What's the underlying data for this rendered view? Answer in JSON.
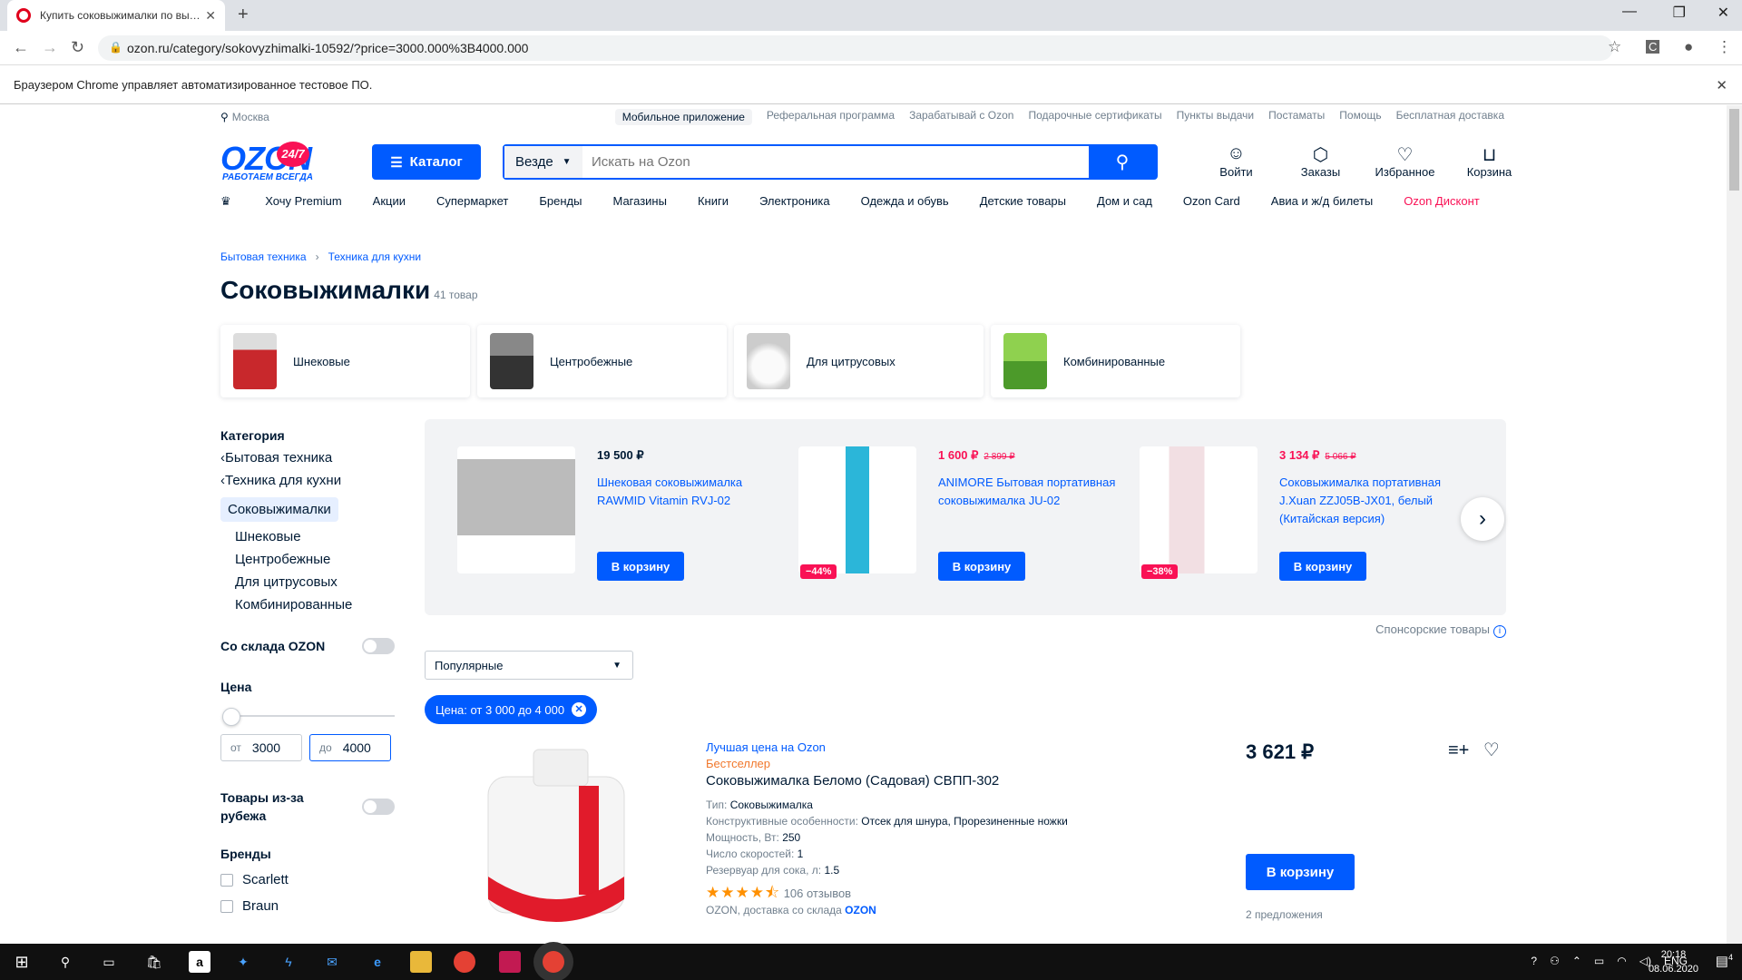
{
  "browser": {
    "tab_title": "Купить соковыжималки по вы…",
    "url": "ozon.ru/category/sokovyzhimalki-10592/?price=3000.000%3B4000.000",
    "infobar": "Браузером Chrome управляет автоматизированное тестовое ПО."
  },
  "header": {
    "city": "Москва",
    "top_links": [
      "Мобильное приложение",
      "Реферальная программа",
      "Зарабатывай с Ozon",
      "Подарочные сертификаты",
      "Пункты выдачи",
      "Постаматы",
      "Помощь",
      "Бесплатная доставка"
    ],
    "logo": "OZON",
    "logo_badge": "24/7",
    "logo_sub": "РАБОТАЕМ ВСЕГДА",
    "catalog_label": "Каталог",
    "search_scope": "Везде",
    "search_placeholder": "Искать на Ozon",
    "icons": [
      {
        "label": "Войти",
        "icon": "user-icon"
      },
      {
        "label": "Заказы",
        "icon": "box-icon"
      },
      {
        "label": "Избранное",
        "icon": "heart-icon"
      },
      {
        "label": "Корзина",
        "icon": "cart-icon"
      }
    ],
    "menu": [
      "Хочу Premium",
      "Акции",
      "Супермаркет",
      "Бренды",
      "Магазины",
      "Книги",
      "Электроника",
      "Одежда и обувь",
      "Детские товары",
      "Дом и сад",
      "Ozon Card",
      "Авиа и ж/д билеты"
    ],
    "menu_red": "Ozon Дисконт"
  },
  "breadcrumbs": [
    "Бытовая техника",
    "Техника для кухни"
  ],
  "page": {
    "title": "Соковыжималки",
    "count": "41 товар"
  },
  "subcategories": [
    {
      "label": "Шнековые",
      "color": "#c8282c"
    },
    {
      "label": "Центробежные",
      "color": "#444444"
    },
    {
      "label": "Для цитрусовых",
      "color": "#e8e8e8"
    },
    {
      "label": "Комбинированные",
      "color": "#6cbf3a"
    }
  ],
  "sidebar": {
    "category_heading": "Категория",
    "back_links": [
      "Бытовая техника",
      "Техника для кухни"
    ],
    "active": "Соковыжималки",
    "subs": [
      "Шнековые",
      "Центробежные",
      "Для цитрусовых",
      "Комбинированные"
    ],
    "ozon_stock": "Со склада OZON",
    "price_heading": "Цена",
    "price_from_prefix": "от",
    "price_from": "3000",
    "price_to_prefix": "до",
    "price_to": "4000",
    "abroad": "Товары из-за рубежа",
    "brands_heading": "Бренды",
    "brands": [
      "Scarlett",
      "Braun"
    ]
  },
  "promo": {
    "items": [
      {
        "price": "19 500 ₽",
        "old": "",
        "name": "Шнековая соковыжималка RAWMID Vitamin RVJ-02",
        "cart": "В корзину",
        "discount": ""
      },
      {
        "price": "1 600 ₽",
        "old": "2 899 ₽",
        "name": "ANIMORE Бытовая портативная соковыжималка JU-02",
        "cart": "В корзину",
        "discount": "−44%"
      },
      {
        "price": "3 134 ₽",
        "old": "5 066 ₽",
        "name": "Соковыжималка портативная J.Xuan ZZJ05B-JX01, белый (Китайская версия)",
        "cart": "В корзину",
        "discount": "−38%"
      }
    ],
    "sponsored": "Спонсорские товары"
  },
  "sort": {
    "value": "Популярные"
  },
  "filter_chip": "Цена: от 3 000 до 4 000",
  "product": {
    "best_price": "Лучшая цена на Ozon",
    "seller_badge": "Бестселлер",
    "name": "Соковыжималка Беломо (Садовая) СВПП-302",
    "attrs": [
      {
        "k": "Тип:",
        "v": "Соковыжималка"
      },
      {
        "k": "Конструктивные особенности:",
        "v": "Отсек для шнура, Прорезиненные ножки"
      },
      {
        "k": "Мощность, Вт:",
        "v": "250"
      },
      {
        "k": "Число скоростей:",
        "v": "1"
      },
      {
        "k": "Резервуар для сока, л:",
        "v": "1.5"
      }
    ],
    "rating": 4.5,
    "reviews": "106 отзывов",
    "delivery": "OZON, доставка со склада",
    "delivery_brand": "OZON",
    "price": "3 621 ₽",
    "cart": "В корзину",
    "offers": "2 предложения"
  },
  "taskbar": {
    "lang": "ENG",
    "time": "20:18",
    "date": "08.06.2020",
    "notifications": "4"
  }
}
